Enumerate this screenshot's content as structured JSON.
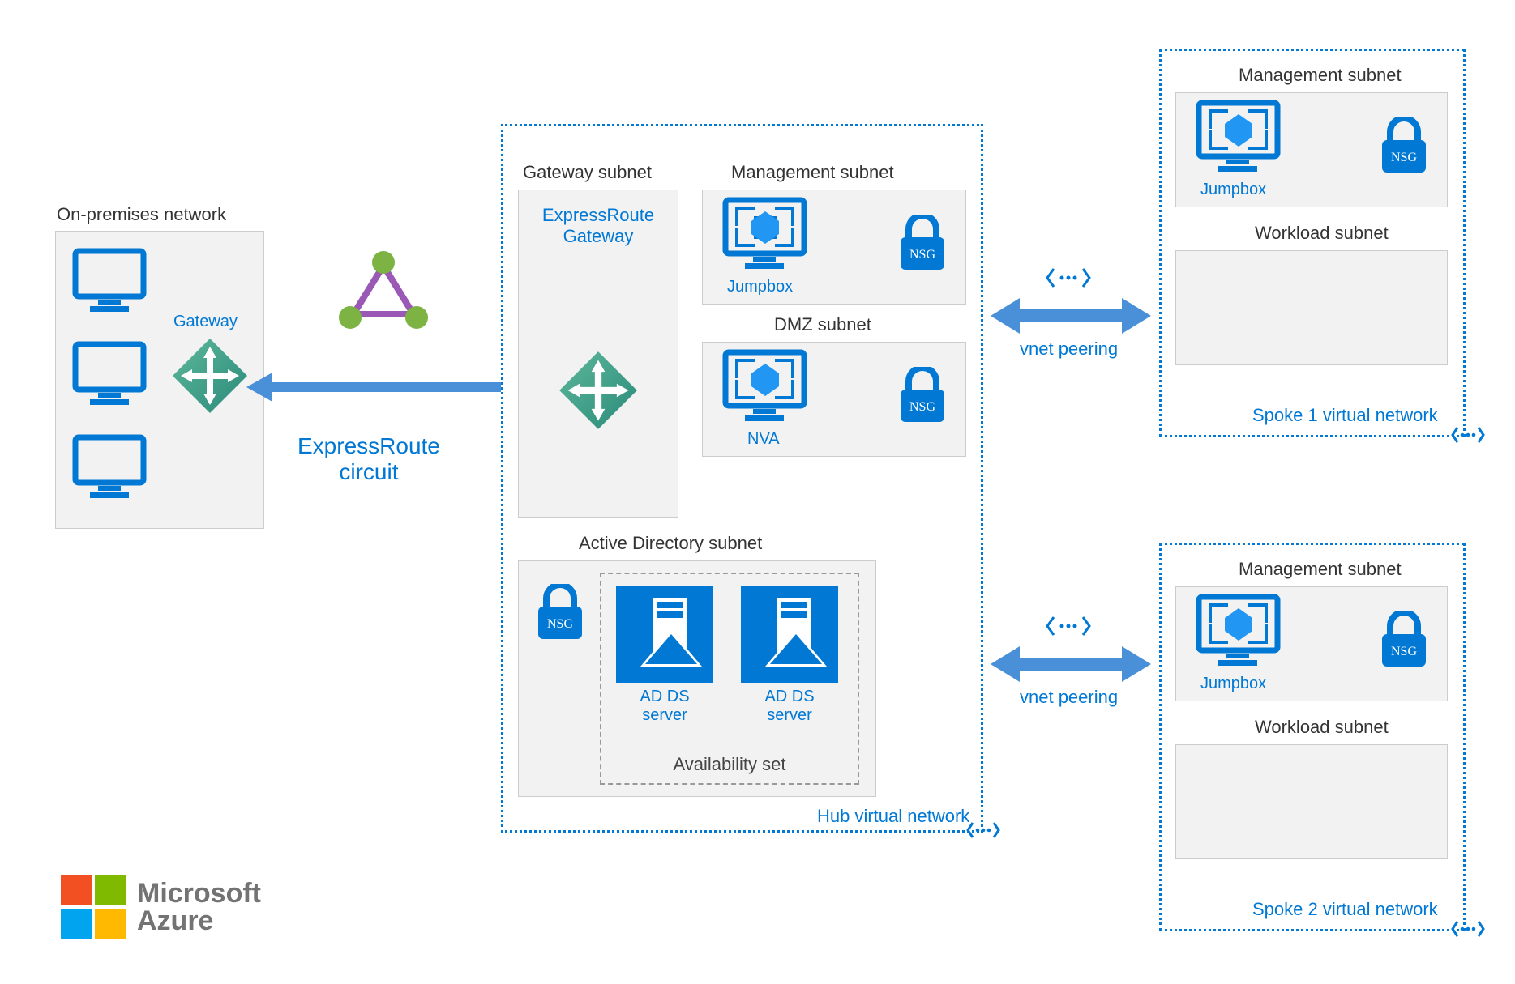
{
  "onprem": {
    "title": "On-premises network",
    "gateway": "Gateway"
  },
  "expressroute": {
    "circuit": "ExpressRoute\ncircuit"
  },
  "hub": {
    "vnet_label": "Hub virtual network",
    "gateway_subnet": {
      "title": "Gateway subnet",
      "er_gateway": "ExpressRoute\nGateway"
    },
    "mgmt_subnet": {
      "title": "Management subnet",
      "jumpbox": "Jumpbox",
      "nsg": "NSG"
    },
    "dmz_subnet": {
      "title": "DMZ subnet",
      "nva": "NVA",
      "nsg": "NSG"
    },
    "ad_subnet": {
      "title": "Active Directory subnet",
      "nsg": "NSG",
      "adds1": "AD DS\nserver",
      "adds2": "AD DS\nserver",
      "avset": "Availability set"
    }
  },
  "peering": {
    "label1": "vnet peering",
    "label2": "vnet peering"
  },
  "spoke1": {
    "vnet_label": "Spoke 1 virtual network",
    "mgmt_subnet": {
      "title": "Management subnet",
      "jumpbox": "Jumpbox",
      "nsg": "NSG"
    },
    "workload_subnet": {
      "title": "Workload subnet"
    }
  },
  "spoke2": {
    "vnet_label": "Spoke 2 virtual network",
    "mgmt_subnet": {
      "title": "Management subnet",
      "jumpbox": "Jumpbox",
      "nsg": "NSG"
    },
    "workload_subnet": {
      "title": "Workload subnet"
    }
  },
  "footer": {
    "brand1": "Microsoft",
    "brand2": "Azure"
  }
}
